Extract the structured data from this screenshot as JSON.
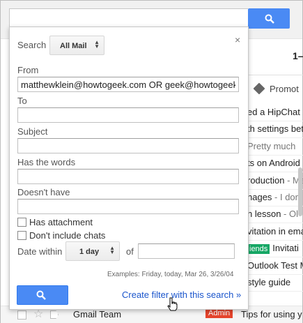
{
  "top": {
    "page_indicator": "1–",
    "promo_tab": "Promot"
  },
  "background_rows": [
    {
      "text": "ed a HipChat",
      "muted": ""
    },
    {
      "text": "th settings bet",
      "muted": ""
    },
    {
      "text": "",
      "muted": "Pretty much"
    },
    {
      "text": "ts on Android",
      "muted": ""
    },
    {
      "text": "roduction",
      "muted": " - Ma"
    },
    {
      "text": "nages",
      "muted": " - I don'"
    },
    {
      "text": "n lesson",
      "muted": " - Ol"
    },
    {
      "text": "vitation in ema",
      "muted": ""
    },
    {
      "text": "Invitati",
      "muted": "",
      "badge": "iends"
    },
    {
      "text": "Outlook Test M",
      "muted": ""
    },
    {
      "text": "style guide",
      "muted": ""
    }
  ],
  "bottom_row": {
    "sender": "Gmail Team",
    "badge": "Admin",
    "subject": "Tips for using y"
  },
  "dialog": {
    "search_label": "Search",
    "scope_value": "All Mail",
    "close_glyph": "×",
    "from_label": "From",
    "from_value": "matthewklein@howtogeek.com OR geek@howtogeek.",
    "to_label": "To",
    "to_value": "",
    "subject_label": "Subject",
    "subject_value": "",
    "has_words_label": "Has the words",
    "has_words_value": "",
    "doesnt_have_label": "Doesn't have",
    "doesnt_have_value": "",
    "has_attachment_label": "Has attachment",
    "has_attachment_checked": false,
    "dont_include_chats_label": "Don't include chats",
    "dont_include_chats_checked": false,
    "date_within_label": "Date within",
    "date_within_value": "1 day",
    "of_label": "of",
    "date_value": "",
    "examples": "Examples: Friday, today, Mar 26, 3/26/04",
    "create_filter_link": "Create filter with this search »"
  },
  "colors": {
    "accent_blue": "#4a8af4",
    "link_blue": "#1a55cc",
    "admin_red": "#e5442c",
    "label_green": "#16a765"
  }
}
